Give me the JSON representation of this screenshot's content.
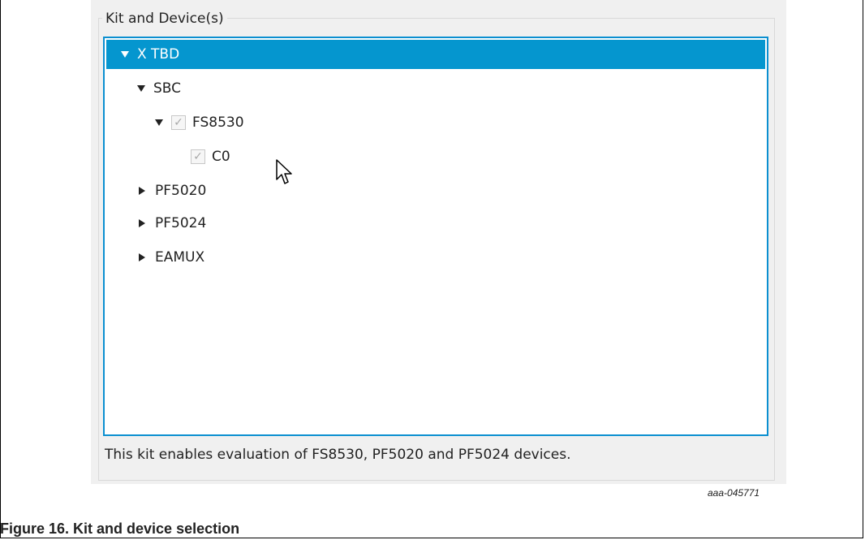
{
  "group_title": "Kit and Device(s)",
  "tree": {
    "root": {
      "label": "X TBD",
      "expanded": true,
      "selected": true
    },
    "items": [
      {
        "label": "SBC",
        "expanded": true
      },
      {
        "label": "FS8530",
        "expanded": true,
        "checked": true
      },
      {
        "label": "C0",
        "checked": true
      },
      {
        "label": "PF5020",
        "expanded": false
      },
      {
        "label": "PF5024",
        "expanded": false
      },
      {
        "label": "EAMUX",
        "expanded": false
      }
    ]
  },
  "description": "This kit enables evaluation of FS8530, PF5020 and PF5024 devices.",
  "figure_code": "aaa-045771",
  "caption": "Figure 16.  Kit and device selection",
  "colors": {
    "selection": "#0596cf",
    "tree_border": "#0b8fd0"
  },
  "icons": [
    "expand-down-icon",
    "expand-right-icon",
    "checkbox-check-icon",
    "mouse-cursor-icon"
  ]
}
